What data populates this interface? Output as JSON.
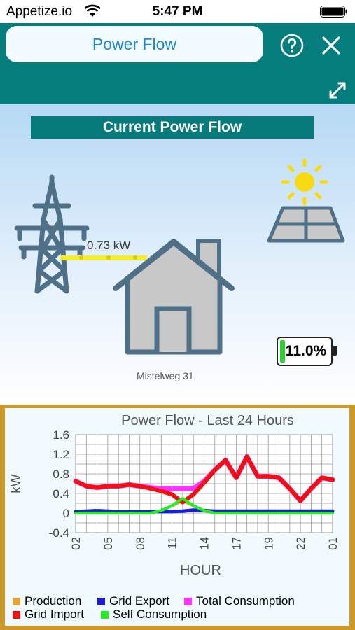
{
  "status_bar": {
    "carrier": "Appetize.io",
    "time": "5:47 PM"
  },
  "header": {
    "title": "Power Flow"
  },
  "scene": {
    "title": "Current Power Flow",
    "grid_power": "0.73 kW",
    "address": "Mistelweg 31",
    "battery_percent": "11.0%",
    "battery_level": 0.11
  },
  "colors": {
    "header_bg": "#067d7d",
    "title_text": "#1f87d6",
    "panel_border": "#cc9a2a",
    "icon_blue": "#4f7086",
    "battery_green": "#2ed12e"
  },
  "chart_data": {
    "type": "line",
    "title": "Power Flow - Last 24 Hours",
    "xlabel": "HOUR",
    "ylabel": "kW",
    "ylim": [
      -0.4,
      1.6
    ],
    "yticks": [
      "-0.4",
      "0",
      "0.4",
      "0.8",
      "1.2",
      "1.6"
    ],
    "xticks": [
      "02",
      "05",
      "08",
      "11",
      "14",
      "17",
      "19",
      "22",
      "01"
    ],
    "x": [
      2,
      3,
      4,
      5,
      6,
      7,
      8,
      9,
      10,
      11,
      12,
      13,
      14,
      15,
      16,
      17,
      18,
      19,
      20,
      21,
      22,
      23,
      24,
      25,
      26
    ],
    "grid": true,
    "legend_position": "bottom",
    "series": [
      {
        "name": "Production",
        "color": "#e6a13a",
        "values": [
          0,
          0,
          0,
          0,
          0,
          0,
          0,
          0,
          0.05,
          0.15,
          0.25,
          0.15,
          0.05,
          0,
          0,
          0,
          0,
          0,
          0,
          0,
          0,
          0,
          0,
          0,
          0
        ]
      },
      {
        "name": "Grid Export",
        "color": "#1c1cd6",
        "values": [
          0.03,
          0.04,
          0.05,
          0.04,
          0.03,
          0.03,
          0.03,
          0.03,
          0.03,
          0.03,
          0.04,
          0.06,
          0.05,
          0.04,
          0.04,
          0.04,
          0.04,
          0.04,
          0.04,
          0.04,
          0.04,
          0.04,
          0.04,
          0.04,
          0.04
        ]
      },
      {
        "name": "Total Consumption",
        "color": "#ff33ff",
        "values": [
          0.65,
          0.55,
          0.52,
          0.55,
          0.55,
          0.58,
          0.55,
          0.52,
          0.5,
          0.5,
          0.5,
          0.5,
          0.65,
          0.88,
          1.08,
          0.72,
          1.15,
          0.75,
          0.75,
          0.72,
          0.5,
          0.25,
          0.5,
          0.72,
          0.68
        ]
      },
      {
        "name": "Grid Import",
        "color": "#ee1111",
        "values": [
          0.65,
          0.55,
          0.52,
          0.55,
          0.55,
          0.58,
          0.55,
          0.5,
          0.45,
          0.38,
          0.22,
          0.38,
          0.62,
          0.88,
          1.08,
          0.72,
          1.15,
          0.75,
          0.75,
          0.72,
          0.5,
          0.25,
          0.5,
          0.72,
          0.68
        ]
      },
      {
        "name": "Self Consumption",
        "color": "#22ee22",
        "values": [
          0,
          0,
          0,
          0,
          0,
          0,
          0,
          0,
          0.05,
          0.15,
          0.3,
          0.15,
          0.05,
          0,
          0,
          0,
          0,
          0,
          0,
          0,
          0,
          0,
          0,
          0,
          0
        ]
      }
    ]
  }
}
